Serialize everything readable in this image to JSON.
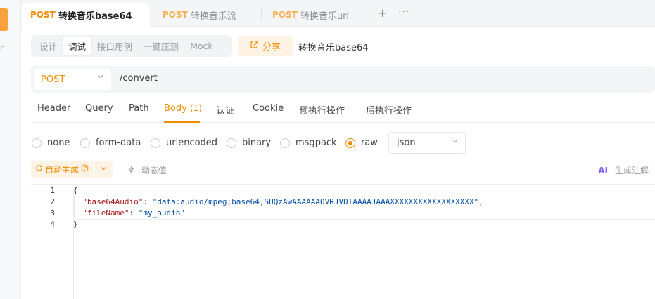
{
  "sidebar": {
    "glyph": "c"
  },
  "tabs": [
    {
      "method": "POST",
      "label": "转换音乐base64",
      "active": true
    },
    {
      "method": "POST",
      "label": "转换音乐流",
      "active": false
    },
    {
      "method": "POST",
      "label": "转换音乐url",
      "active": false
    }
  ],
  "tabbar": {
    "add_icon": "+",
    "more_icon": "···"
  },
  "modes": [
    "设计",
    "调试",
    "接口用例",
    "一键压测",
    "Mock"
  ],
  "share": {
    "label": "分享",
    "icon": "share-icon"
  },
  "api_name": "转换音乐base64",
  "request": {
    "method": "POST",
    "path": "/convert"
  },
  "request_tabs": {
    "header": "Header",
    "query": "Query",
    "path": "Path",
    "body": "Body",
    "body_count": "(1)",
    "auth": "认证",
    "cookie": "Cookie",
    "pre": "预执行操作",
    "post": "后执行操作"
  },
  "body_types": {
    "none": "none",
    "form_data": "form-data",
    "urlencoded": "urlencoded",
    "binary": "binary",
    "msgpack": "msgpack",
    "raw": "raw",
    "selected": "raw"
  },
  "format": "json",
  "toolbar": {
    "auto_generate": "自动生成",
    "dynamic_value": "动态值",
    "ai_label": "AI",
    "ai_annotation": "生成注解"
  },
  "code": {
    "line_numbers": [
      "1",
      "2",
      "3",
      "4"
    ],
    "open_brace": "{",
    "close_brace": "}",
    "key1": "\"base64Audio\"",
    "val1": "\"data:audio/mpeg;base64,SUQzAwAAAAAAOVRJVDIAAAAJAAAXXXXXXXXXXXXXXXXXX\"",
    "key2": "\"fileName\"",
    "val2": "\"my_audio\""
  },
  "colors": {
    "accent": "#f08c00",
    "accent_bg": "#fff3e6",
    "ai": "#7a5cf5"
  }
}
